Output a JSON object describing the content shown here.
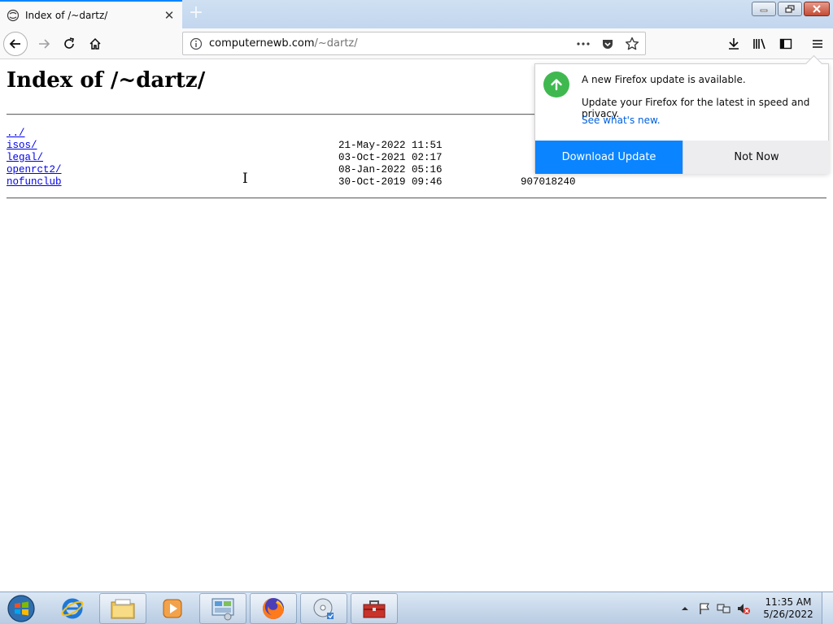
{
  "browser": {
    "tab": {
      "title": "Index of /~dartz/"
    },
    "url": {
      "host": "computernewb.com",
      "path": "/~dartz/"
    }
  },
  "page": {
    "heading": "Index of /~dartz/",
    "entries": [
      {
        "name": "../",
        "date": "",
        "size": ""
      },
      {
        "name": "isos/",
        "date": "21-May-2022 11:51",
        "size": ""
      },
      {
        "name": "legal/",
        "date": "03-Oct-2021 02:17",
        "size": ""
      },
      {
        "name": "openrct2/",
        "date": "08-Jan-2022 05:16",
        "size": ""
      },
      {
        "name": "nofunclub",
        "date": "30-Oct-2019 09:46",
        "size": "907018240"
      }
    ]
  },
  "update_panel": {
    "title": "A new Firefox update is available.",
    "description": "Update your Firefox for the latest in speed and privacy.",
    "link": "See what's new.",
    "primary_button": "Download Update",
    "secondary_button": "Not Now"
  },
  "taskbar": {
    "time": "11:35 AM",
    "date": "5/26/2022"
  },
  "colors": {
    "accent": "#0a84ff",
    "update_green": "#3fb94f",
    "link": "#0000ee"
  }
}
